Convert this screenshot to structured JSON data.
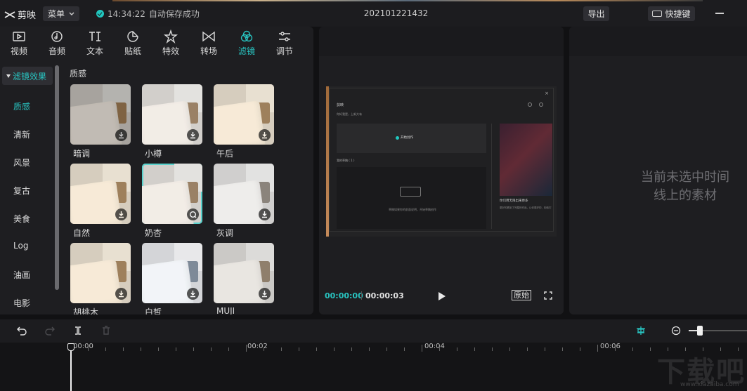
{
  "app": {
    "name": "剪映",
    "menu_label": "菜单",
    "save_time": "14:34:22",
    "save_status": "自动保存成功",
    "project_title": "202101221432",
    "export_label": "导出",
    "shortcut_label": "快捷键"
  },
  "tools": [
    {
      "label": "视频",
      "icon": "video-icon"
    },
    {
      "label": "音频",
      "icon": "audio-icon"
    },
    {
      "label": "文本",
      "icon": "text-icon"
    },
    {
      "label": "贴纸",
      "icon": "sticker-icon"
    },
    {
      "label": "特效",
      "icon": "effects-icon"
    },
    {
      "label": "转场",
      "icon": "transition-icon"
    },
    {
      "label": "滤镜",
      "icon": "filter-icon",
      "active": true
    },
    {
      "label": "调节",
      "icon": "adjust-icon"
    }
  ],
  "categories": {
    "header": "滤镜效果",
    "items": [
      "质感",
      "清新",
      "风景",
      "复古",
      "美食",
      "Log",
      "油画",
      "电影"
    ],
    "active_index": 0
  },
  "filters": {
    "section_title": "质感",
    "items": [
      {
        "label": "暗调",
        "style": "c-dark",
        "state": "download"
      },
      {
        "label": "小樽",
        "style": "c-light",
        "state": "download"
      },
      {
        "label": "午后",
        "style": "c-warm",
        "state": "download"
      },
      {
        "label": "自然",
        "style": "c-warm",
        "state": "download"
      },
      {
        "label": "奶杏",
        "style": "c-light",
        "state": "loading",
        "selected": true
      },
      {
        "label": "灰调",
        "style": "c-grey",
        "state": "download"
      },
      {
        "label": "胡桃木",
        "style": "c-warm",
        "state": "download"
      },
      {
        "label": "白皙",
        "style": "c-blue",
        "state": "download"
      },
      {
        "label": "MUJI",
        "style": "c-muji",
        "state": "download"
      }
    ]
  },
  "player": {
    "current_time": "00:00:00",
    "total_time": "00:00:03",
    "ratio_label": "原始",
    "preview": {
      "logo": "剪映",
      "subtitle": "你好我是，上新大有",
      "start_label": "开始创作",
      "draft_label": "我的草稿 ( 1 )",
      "drop_hint": "草稿如果你的前面说明，开始草稿创作",
      "video_caption": "你们用无限出来更多",
      "video_sub": "更好的看到了完整的作品，让你更好的，相信它"
    }
  },
  "inspector": {
    "empty_message_line1": "当前未选中时间",
    "empty_message_line2": "线上的素材"
  },
  "timeline": {
    "ticks": [
      "00:00",
      "00:02",
      "00:04",
      "00:06"
    ],
    "zoom_level": 0.2
  },
  "watermark": {
    "text": "下载吧",
    "url": "www.xiazaiba.com"
  },
  "colors": {
    "accent": "#28c3c0",
    "panel": "#1e1e21",
    "background": "#111113"
  }
}
